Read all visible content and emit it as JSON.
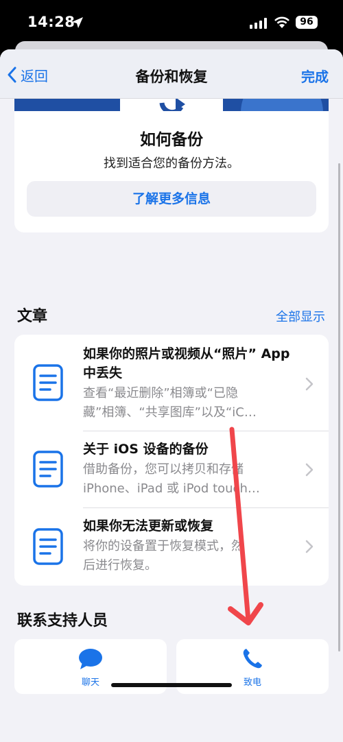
{
  "status_bar": {
    "time": "14:28",
    "battery": "96"
  },
  "nav": {
    "back_label": "返回",
    "title": "备份和恢复",
    "done_label": "完成"
  },
  "how_to": {
    "title": "如何备份",
    "subtitle": "找到适合您的备份方法。",
    "button_label": "了解更多信息"
  },
  "articles": {
    "heading": "文章",
    "show_all": "全部显示",
    "items": [
      {
        "title": "如果你的照片或视频从“照片” App 中丢失",
        "desc_line1": "查看“最近删除”相簿或“已隐",
        "desc_line2": "藏”相簿、“共享图库”以及“iC…",
        "icon": "document-icon"
      },
      {
        "title": "关于 iOS 设备的备份",
        "desc_line1": "借助备份，您可以拷贝和存储",
        "desc_line2": "iPhone、iPad 或 iPod touch…",
        "icon": "document-icon"
      },
      {
        "title": "如果你无法更新或恢复",
        "desc_line1": "将你的设备置于恢复模式，然",
        "desc_line2": "后进行恢复。",
        "icon": "document-icon"
      }
    ]
  },
  "contact": {
    "heading": "联系支持人员",
    "chat_label": "聊天",
    "call_label": "致电"
  },
  "colors": {
    "accent": "#1a73e8",
    "background": "#f2f2f7",
    "hero": "#1f4fa3",
    "annotation_arrow": "#f0464b"
  }
}
